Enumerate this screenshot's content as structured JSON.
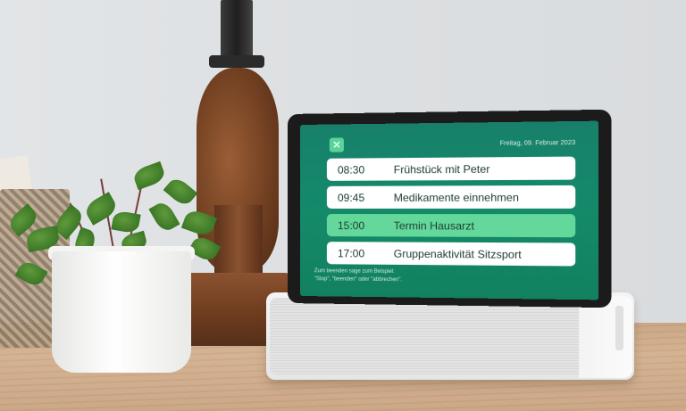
{
  "schedule_screen": {
    "date": "Freitag, 09. Februar 2023",
    "close_icon": "close-x-icon",
    "items": [
      {
        "time": "08:30",
        "title": "Frühstück mit Peter",
        "active": false
      },
      {
        "time": "09:45",
        "title": "Medikamente einnehmen",
        "active": false
      },
      {
        "time": "15:00",
        "title": "Termin Hausarzt",
        "active": true
      },
      {
        "time": "17:00",
        "title": "Gruppenaktivität Sitzsport",
        "active": false
      }
    ],
    "hint_line1": "Zum beenden sage zum Beispiel:",
    "hint_line2": "\"Stop\", \"beenden\" oder \"abbrechen\"."
  },
  "colors": {
    "screen_background": "#148a6a",
    "active_row": "#63d89a",
    "row": "#ffffff",
    "close_button": "#5ad39a"
  }
}
